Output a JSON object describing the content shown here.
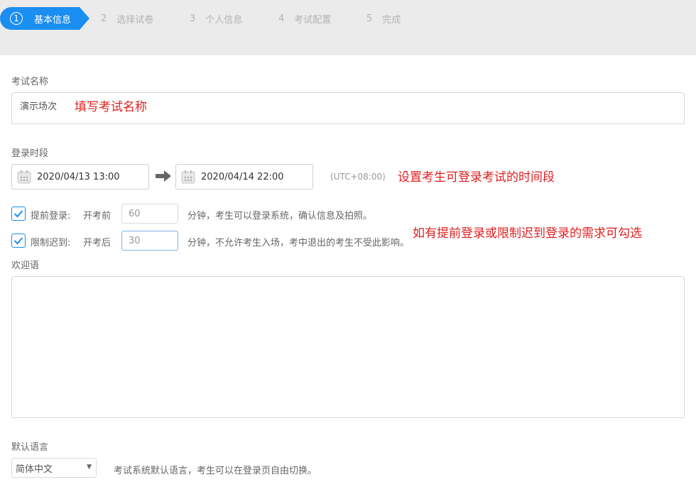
{
  "stepper": {
    "steps": [
      {
        "num": "1",
        "label": "基本信息"
      },
      {
        "num": "2",
        "label": "选择试卷"
      },
      {
        "num": "3",
        "label": "个人信息"
      },
      {
        "num": "4",
        "label": "考试配置"
      },
      {
        "num": "5",
        "label": "完成"
      }
    ],
    "active_step": "1"
  },
  "exam_name": {
    "label": "考试名称",
    "value": "演示场次",
    "annotation": "填写考试名称"
  },
  "login_period": {
    "label": "登录时段",
    "start": "2020/04/13 13:00",
    "end": "2020/04/14 22:00",
    "timezone": "(UTC+08:00)",
    "annotation": "设置考生可登录考试的时间段"
  },
  "early_login": {
    "checked": true,
    "label": "提前登录:",
    "prefix": "开考前",
    "value": "60",
    "suffix": "分钟，考生可以登录系统，确认信息及拍照。"
  },
  "late_limit": {
    "checked": true,
    "label": "限制迟到:",
    "prefix": "开考后",
    "value": "30",
    "suffix": "分钟，不允许考生入场，考中退出的考生不受此影响。"
  },
  "restriction_annotation": "如有提前登录或限制迟到登录的需求可勾选",
  "welcome": {
    "label": "欢迎语",
    "value": ""
  },
  "language": {
    "label": "默认语言",
    "selected": "简体中文",
    "hint": "考试系统默认语言，考生可以在登录页自由切换。"
  },
  "colors": {
    "accent": "#1a8ef1",
    "annotation": "#e02020"
  }
}
